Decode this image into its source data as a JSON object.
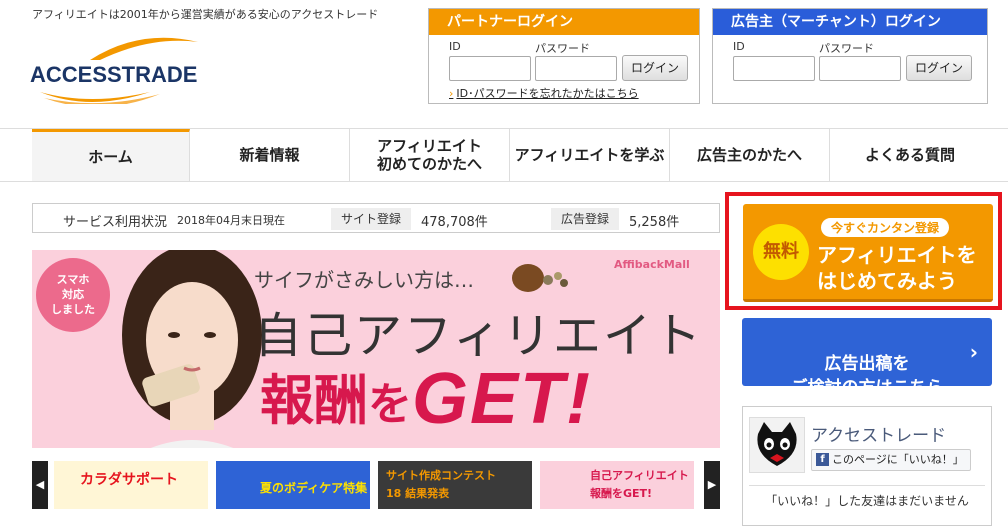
{
  "header": {
    "tagline": "アフィリエイトは2001年から運営実績がある安心のアクセストレード",
    "logo_text": "ACCESSTRADE"
  },
  "partner_login": {
    "title": "パートナーログイン",
    "id_label": "ID",
    "password_label": "パスワード",
    "button": "ログイン",
    "forgot_link": "ID･パスワードを忘れたかたはこちら"
  },
  "advertiser_login": {
    "title": "広告主（マーチャント）ログイン",
    "id_label": "ID",
    "password_label": "パスワード",
    "button": "ログイン"
  },
  "nav": {
    "items": [
      {
        "label": "ホーム",
        "active": true
      },
      {
        "label": "新着情報"
      },
      {
        "label": "アフィリエイト\n初めてのかたへ"
      },
      {
        "label": "アフィリエイトを学ぶ"
      },
      {
        "label": "広告主のかたへ"
      },
      {
        "label": "よくある質問"
      }
    ]
  },
  "status": {
    "title": "サービス利用状況",
    "date": "2018年04月末日現在",
    "sites_label": "サイト登録",
    "sites_value": "478,708件",
    "ads_label": "広告登録",
    "ads_value": "5,258件"
  },
  "hero": {
    "badge": "スマホ\n対応\nしました",
    "subtitle": "サイフがさみしい方は…",
    "brand": "AffibackMall",
    "title": "自己アフィリエイト",
    "get_1": "報酬",
    "get_2": "を",
    "get_3": "GET!"
  },
  "thumbnails": [
    {
      "label": "カラダサポート",
      "bg": "#fff6d6",
      "color": "#e6141e"
    },
    {
      "label": "夏のボディケア特集",
      "bg": "#2e63d6",
      "color": "#fde000"
    },
    {
      "label": "サイト作成コンテスト18 結果発表",
      "bg": "#3a3a3a",
      "color": "#f39800"
    },
    {
      "label": "自己アフィリエイト 報酬をGET!",
      "bg": "#fbd0dc",
      "color": "#d7184d"
    }
  ],
  "carousel": {
    "prev_icon": "◀",
    "next_icon": "▶"
  },
  "cta": {
    "free": "無料",
    "pill": "今すぐカンタン登録",
    "main": "アフィリエイトを\nはじめてみよう"
  },
  "advertiser_cta": {
    "text": "広告出稿を\nご検討の方はこちら",
    "chevron": "›"
  },
  "facebook": {
    "name": "アクセストレード",
    "like": "このページに「いいね！」",
    "fb_letter": "f",
    "friends": "「いいね！」した友達はまだいません"
  }
}
